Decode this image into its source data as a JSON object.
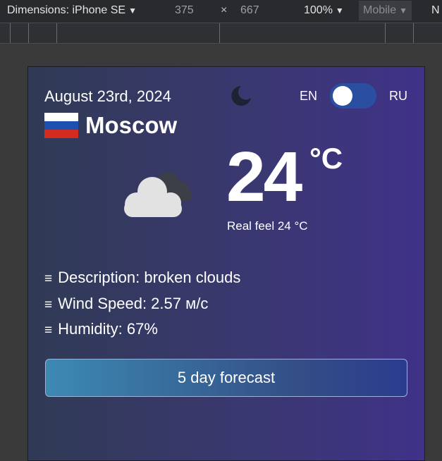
{
  "toolbar": {
    "device_label": "Dimensions: iPhone SE",
    "width_value": "375",
    "times_symbol": "×",
    "height_value": "667",
    "zoom_label": "100%",
    "mode_label": "Mobile",
    "more_label": "N",
    "caret": "▼"
  },
  "weather": {
    "date": "August 23rd, 2024",
    "lang_en": "EN",
    "lang_ru": "RU",
    "language_toggle_on": false,
    "theme_icon": "moon-icon",
    "country_flag_icon": "russia-flag-icon",
    "city": "Moscow",
    "condition_icon": "broken-clouds-icon",
    "temperature": "24",
    "unit": "°C",
    "real_feel": "Real feel 24 °C",
    "details_icon": "≡",
    "description": "Description: broken clouds",
    "wind_speed": "Wind Speed: 2.57 м/с",
    "humidity": "Humidity: 67%",
    "forecast_button": "5 day forecast"
  },
  "colors": {
    "toolbar_bg": "#292a2d",
    "card_gradient_start": "#303a55",
    "card_gradient_end": "#3f3288",
    "toggle_track": "#2b4fa0",
    "button_gradient_start": "#3c8ab3",
    "button_gradient_end": "#2a3c8e"
  }
}
